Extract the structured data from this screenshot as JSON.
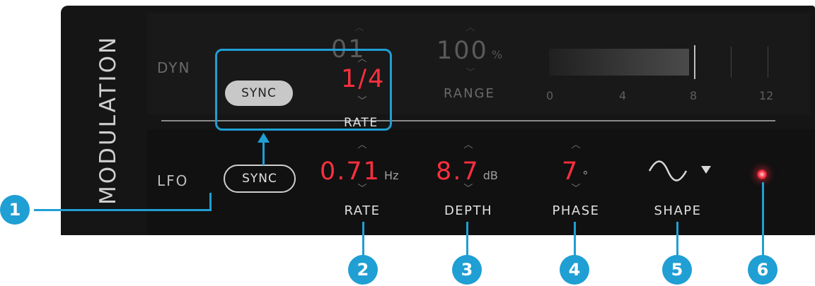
{
  "section_title": "MODULATION",
  "dyn": {
    "label": "DYN",
    "sync_label": "SYNC",
    "partial_value": "01",
    "rate_value": "1/4",
    "rate_label": "RATE",
    "range_value": "100",
    "range_unit": "%",
    "range_label": "RANGE",
    "meter_ticks": [
      "0",
      "4",
      "8",
      "12"
    ]
  },
  "lfo": {
    "label": "LFO",
    "sync_label": "SYNC",
    "rate_value": "0.71",
    "rate_unit": "Hz",
    "rate_label": "RATE",
    "depth_value": "8.7",
    "depth_unit": "dB",
    "depth_label": "DEPTH",
    "phase_value": "7",
    "phase_unit": "°",
    "phase_label": "PHASE",
    "shape_label": "SHAPE",
    "shape_icon": "sine-wave-icon",
    "dropdown_icon": "triangle-down-icon",
    "led_icon": "led-indicator-icon"
  },
  "chevron_up": "︿",
  "chevron_down": "﹀",
  "callouts": [
    "1",
    "2",
    "3",
    "4",
    "5",
    "6"
  ],
  "colors": {
    "accent": "#1f9fd3",
    "value_red": "#ff2f3f",
    "led": "#ff3d4d",
    "panel": "#151515"
  }
}
